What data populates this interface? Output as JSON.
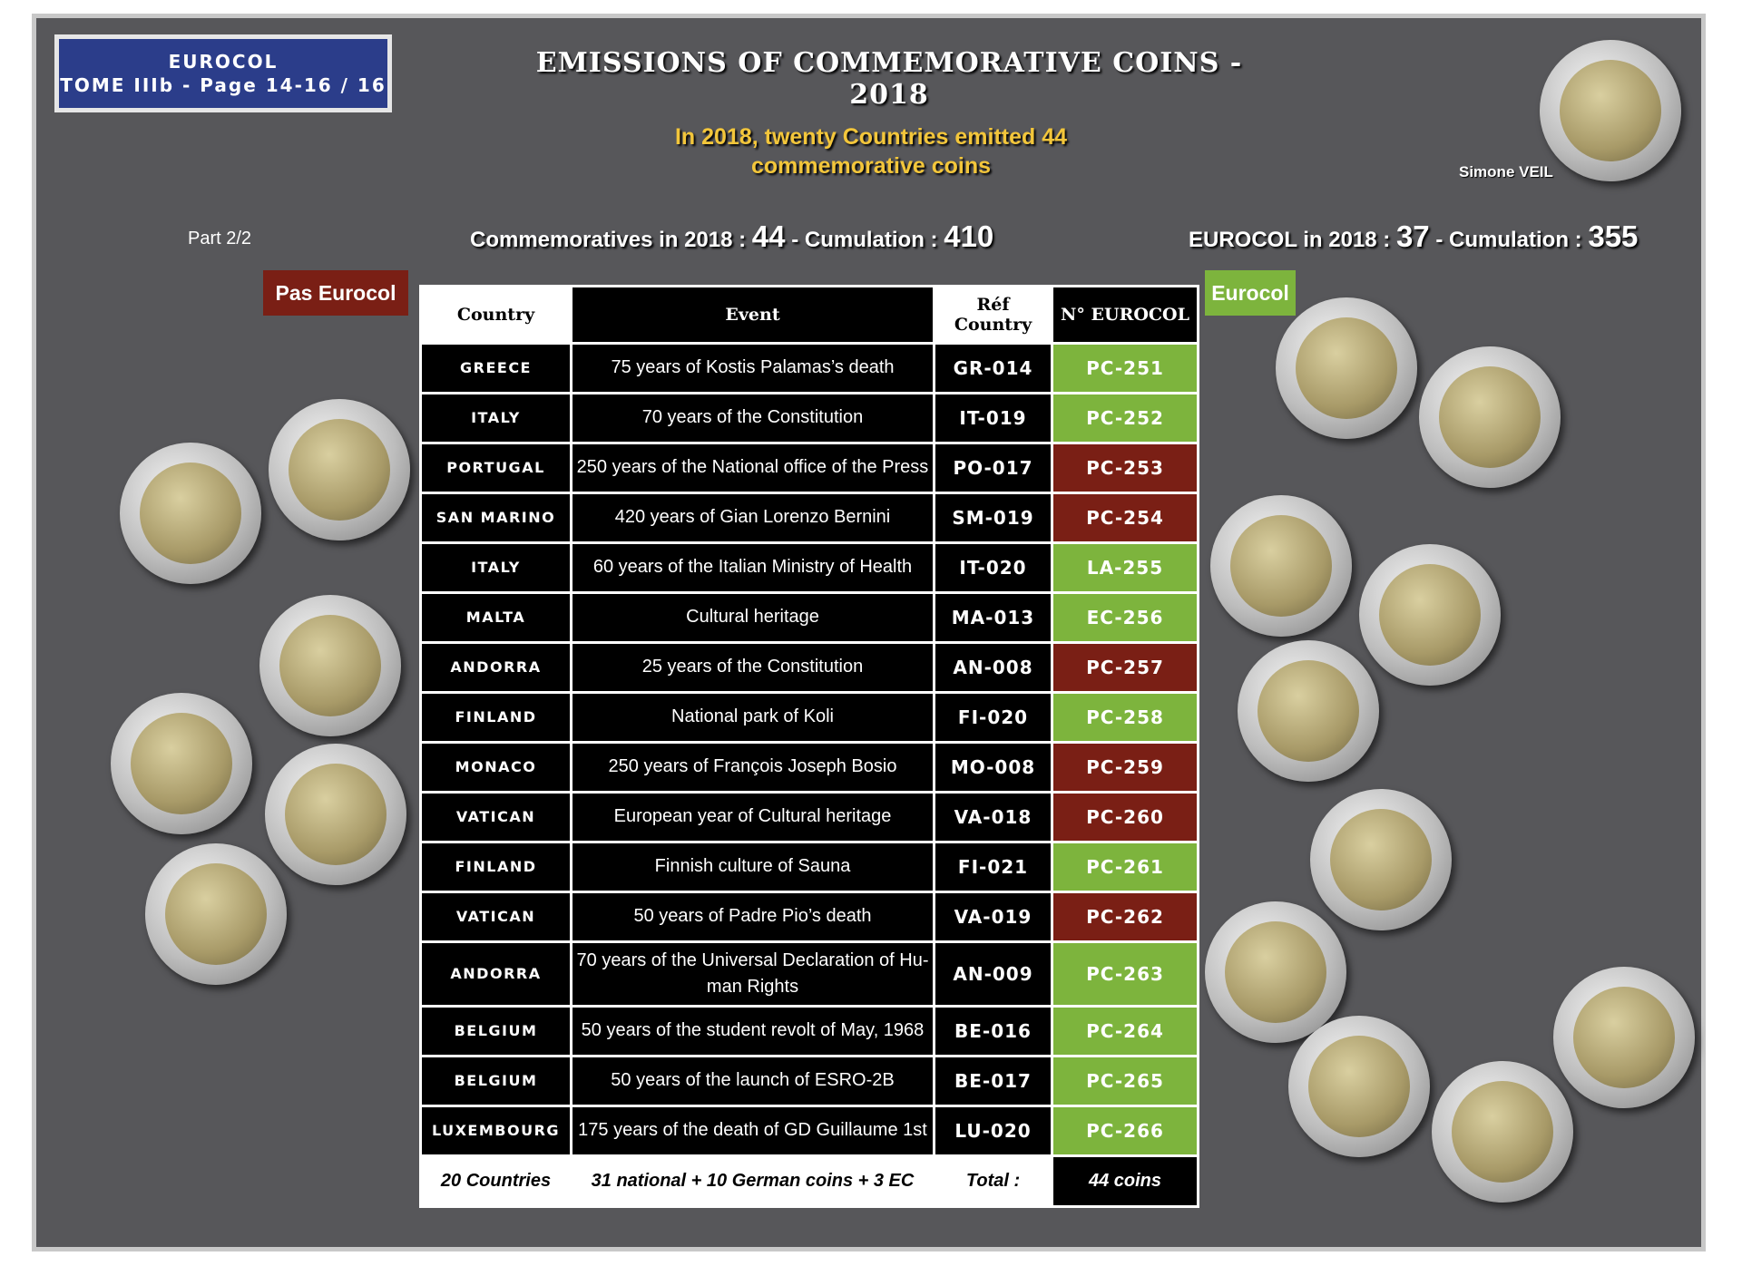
{
  "badge": {
    "line1": "EUROCOL",
    "line2": "TOME IIIb - Page 14-16 / 16"
  },
  "title": "EMISSIONS OF COMMEMORATIVE COINS - 2018",
  "subtitle": {
    "line1": "In 2018, twenty Countries emitted 44",
    "line2": "commemorative coins"
  },
  "part_label": "Part 2/2",
  "stats_left": {
    "label1": "Commemoratives in 2018 :",
    "value1": "44",
    "sep": "-",
    "label2": "Cumulation :",
    "value2": "410"
  },
  "stats_right": {
    "label1": "EUROCOL in 2018 :",
    "value1": "37",
    "sep": "-",
    "label2": "Cumulation :",
    "value2": "355"
  },
  "featured_coin_label": "Simone VEIL",
  "legend": {
    "pas_eurocol": {
      "label": "Pas Eurocol",
      "color": "#7a1f15"
    },
    "eurocol": {
      "label": "Eurocol",
      "color": "#7db43d"
    }
  },
  "table": {
    "headers": [
      "Country",
      "Event",
      "Réf Country",
      "N° EUROCOL"
    ],
    "rows": [
      {
        "country": "GREECE",
        "event": "75 years of Kostis Palamas’s death",
        "ref": "GR-014",
        "eurocol": "PC-251",
        "status": "eurocol"
      },
      {
        "country": "ITALY",
        "event": "70 years of the Constitution",
        "ref": "IT-019",
        "eurocol": "PC-252",
        "status": "eurocol"
      },
      {
        "country": "PORTUGAL",
        "event": "250 years of the National office of the Press",
        "ref": "PO-017",
        "eurocol": "PC-253",
        "status": "pas"
      },
      {
        "country": "SAN MARINO",
        "event": "420 years of Gian Lorenzo Bernini",
        "ref": "SM-019",
        "eurocol": "PC-254",
        "status": "pas"
      },
      {
        "country": "ITALY",
        "event": "60 years of the Italian Ministry of Health",
        "ref": "IT-020",
        "eurocol": "LA-255",
        "status": "eurocol"
      },
      {
        "country": "MALTA",
        "event": "Cultural heritage",
        "ref": "MA-013",
        "eurocol": "EC-256",
        "status": "eurocol"
      },
      {
        "country": "ANDORRA",
        "event": "25 years of the Constitution",
        "ref": "AN-008",
        "eurocol": "PC-257",
        "status": "pas"
      },
      {
        "country": "FINLAND",
        "event": "National park of Koli",
        "ref": "FI-020",
        "eurocol": "PC-258",
        "status": "eurocol"
      },
      {
        "country": "MONACO",
        "event": "250 years of François Joseph Bosio",
        "ref": "MO-008",
        "eurocol": "PC-259",
        "status": "pas"
      },
      {
        "country": "VATICAN",
        "event": "European year of Cultural heritage",
        "ref": "VA-018",
        "eurocol": "PC-260",
        "status": "pas"
      },
      {
        "country": "FINLAND",
        "event": "Finnish culture of Sauna",
        "ref": "FI-021",
        "eurocol": "PC-261",
        "status": "eurocol"
      },
      {
        "country": "VATICAN",
        "event": "50 years of Padre Pio’s death",
        "ref": "VA-019",
        "eurocol": "PC-262",
        "status": "pas"
      },
      {
        "country": "ANDORRA",
        "event": "70 years of the Universal Declaration of Hu-man Rights",
        "ref": "AN-009",
        "eurocol": "PC-263",
        "status": "eurocol"
      },
      {
        "country": "BELGIUM",
        "event": "50 years of the student revolt of May, 1968",
        "ref": "BE-016",
        "eurocol": "PC-264",
        "status": "eurocol"
      },
      {
        "country": "BELGIUM",
        "event": "50 years of the launch of ESRO-2B",
        "ref": "BE-017",
        "eurocol": "PC-265",
        "status": "eurocol"
      },
      {
        "country": "LUXEMBOURG",
        "event": "175 years of the death of GD Guillaume 1st",
        "ref": "LU-020",
        "eurocol": "PC-266",
        "status": "eurocol"
      }
    ],
    "footer": {
      "countries": "20 Countries",
      "breakdown": "31 national + 10 German coins + 3 EC",
      "total_label": "Total :",
      "total_value": "44 coins"
    }
  }
}
